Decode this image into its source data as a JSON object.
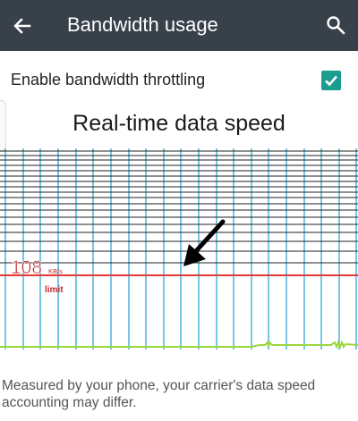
{
  "app_bar": {
    "title": "Bandwidth usage",
    "back_icon": "arrow-left-icon",
    "search_icon": "search-icon",
    "background_color": "#38404a"
  },
  "setting": {
    "label": "Enable bandwidth throttling",
    "checked": true,
    "accent_color": "#1a9c8f"
  },
  "chart_data": {
    "type": "line",
    "title": "Real-time data speed",
    "limit": {
      "value": "108",
      "unit": "KB/s",
      "label": "limit",
      "color": "#e53935"
    },
    "grid_color": "#1fa0d5",
    "grid": true,
    "series": [
      {
        "color": "#9bd63a",
        "x": [
          0,
          280,
          290,
          296,
          299,
          300,
          301,
          304,
          310,
          370,
          374,
          376,
          378,
          380,
          382,
          384,
          386,
          400
        ],
        "values": [
          0,
          0,
          2,
          2,
          5,
          0,
          5,
          2,
          2,
          2,
          5,
          0,
          5,
          0,
          5,
          0,
          3,
          2
        ]
      }
    ],
    "ylim": [
      0,
      200
    ]
  },
  "annotation": {
    "arrow_color": "#000000"
  },
  "footer": {
    "text": "Measured by your phone, your carrier's data speed accounting may differ."
  }
}
